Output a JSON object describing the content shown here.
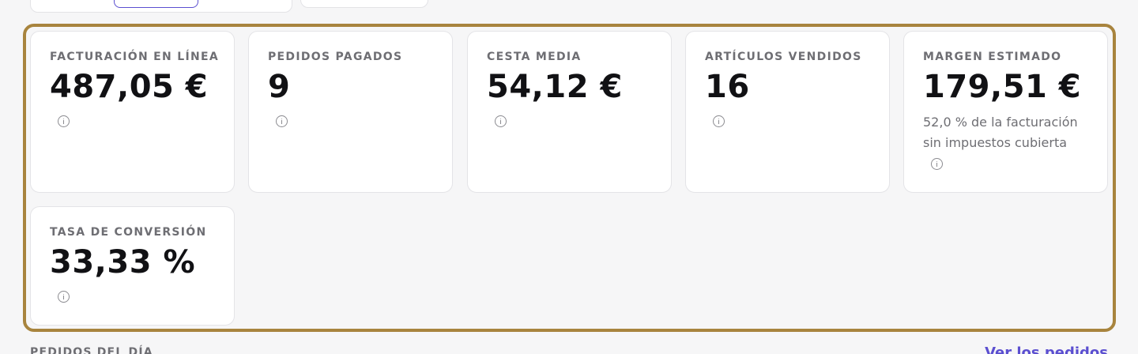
{
  "kpis": [
    {
      "label": "FACTURACIÓN EN LÍNEA",
      "value": "487,05 €",
      "note": ""
    },
    {
      "label": "PEDIDOS PAGADOS",
      "value": "9",
      "note": ""
    },
    {
      "label": "CESTA MEDIA",
      "value": "54,12 €",
      "note": ""
    },
    {
      "label": "ARTÍCULOS VENDIDOS",
      "value": "16",
      "note": ""
    },
    {
      "label": "MARGEN ESTIMADO",
      "value": "179,51 €",
      "note": "52,0 % de la facturación sin impuestos cubierta"
    },
    {
      "label": "TASA DE CONVERSIÓN",
      "value": "33,33 %",
      "note": ""
    }
  ],
  "orders_section": {
    "label": "PEDIDOS DEL DÍA",
    "link": "Ver los pedidos"
  },
  "colors": {
    "accent": "#5b4fd0",
    "highlight_frame": "#a8843e",
    "muted_text": "#6e6e73"
  }
}
